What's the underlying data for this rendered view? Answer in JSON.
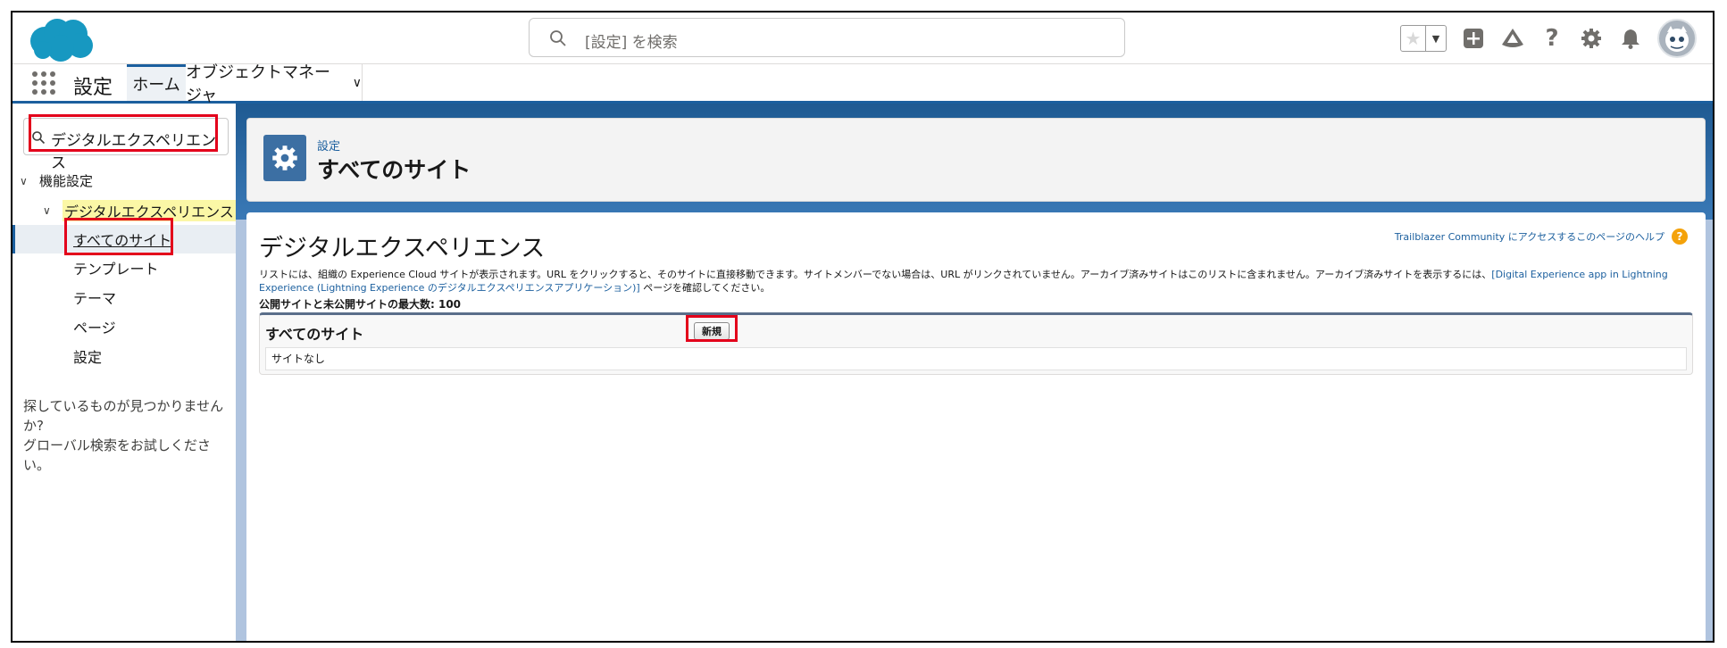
{
  "header": {
    "search_placeholder": "[設定] を検索",
    "favorites_icon": "star-icon",
    "icons": [
      "star-icon",
      "add-icon",
      "trailhead-icon",
      "help-icon",
      "gear-icon",
      "bell-icon",
      "avatar"
    ]
  },
  "nav": {
    "app_name": "設定",
    "tabs": [
      {
        "label": "ホーム",
        "active": true
      },
      {
        "label": "オブジェクトマネージャ",
        "has_dropdown": true
      }
    ]
  },
  "sidebar": {
    "quickfind_value": "デジタルエクスペリエンス",
    "section": "機能設定",
    "group": "デジタルエクスペリエンス",
    "items": [
      {
        "label": "すべてのサイト",
        "selected": true
      },
      {
        "label": "テンプレート"
      },
      {
        "label": "テーマ"
      },
      {
        "label": "ページ"
      },
      {
        "label": "設定"
      }
    ],
    "not_found_line1": "探しているものが見つかりませんか?",
    "not_found_line2": "グローバル検索をお試しください。"
  },
  "page_header": {
    "subtitle": "設定",
    "title": "すべてのサイト",
    "icon": "gear-icon"
  },
  "content": {
    "title": "デジタルエクスペリエンス",
    "help_link": "Trailblazer Community にアクセスするこのページのヘルプ",
    "desc_text": "リストには、組織の Experience Cloud サイトが表示されます。URL をクリックすると、そのサイトに直接移動できます。サイトメンバーでない場合は、URL がリンクされていません。アーカイブ済みサイトはこのリストに含まれません。アーカイブ済みサイトを表示するには、",
    "desc_link": "[Digital Experience app in Lightning Experience (Lightning Experience のデジタルエクスペリエンスアプリケーション)]",
    "desc_tail": " ページを確認してください。",
    "max_sites": "公開サイトと未公開サイトの最大数: 100",
    "block_title": "すべてのサイト",
    "new_button": "新規",
    "empty_text": "サイトなし"
  },
  "colors": {
    "brand_blue": "#1b5f9e",
    "highlight_red": "#e3001b",
    "search_highlight": "#fbf7a6"
  }
}
